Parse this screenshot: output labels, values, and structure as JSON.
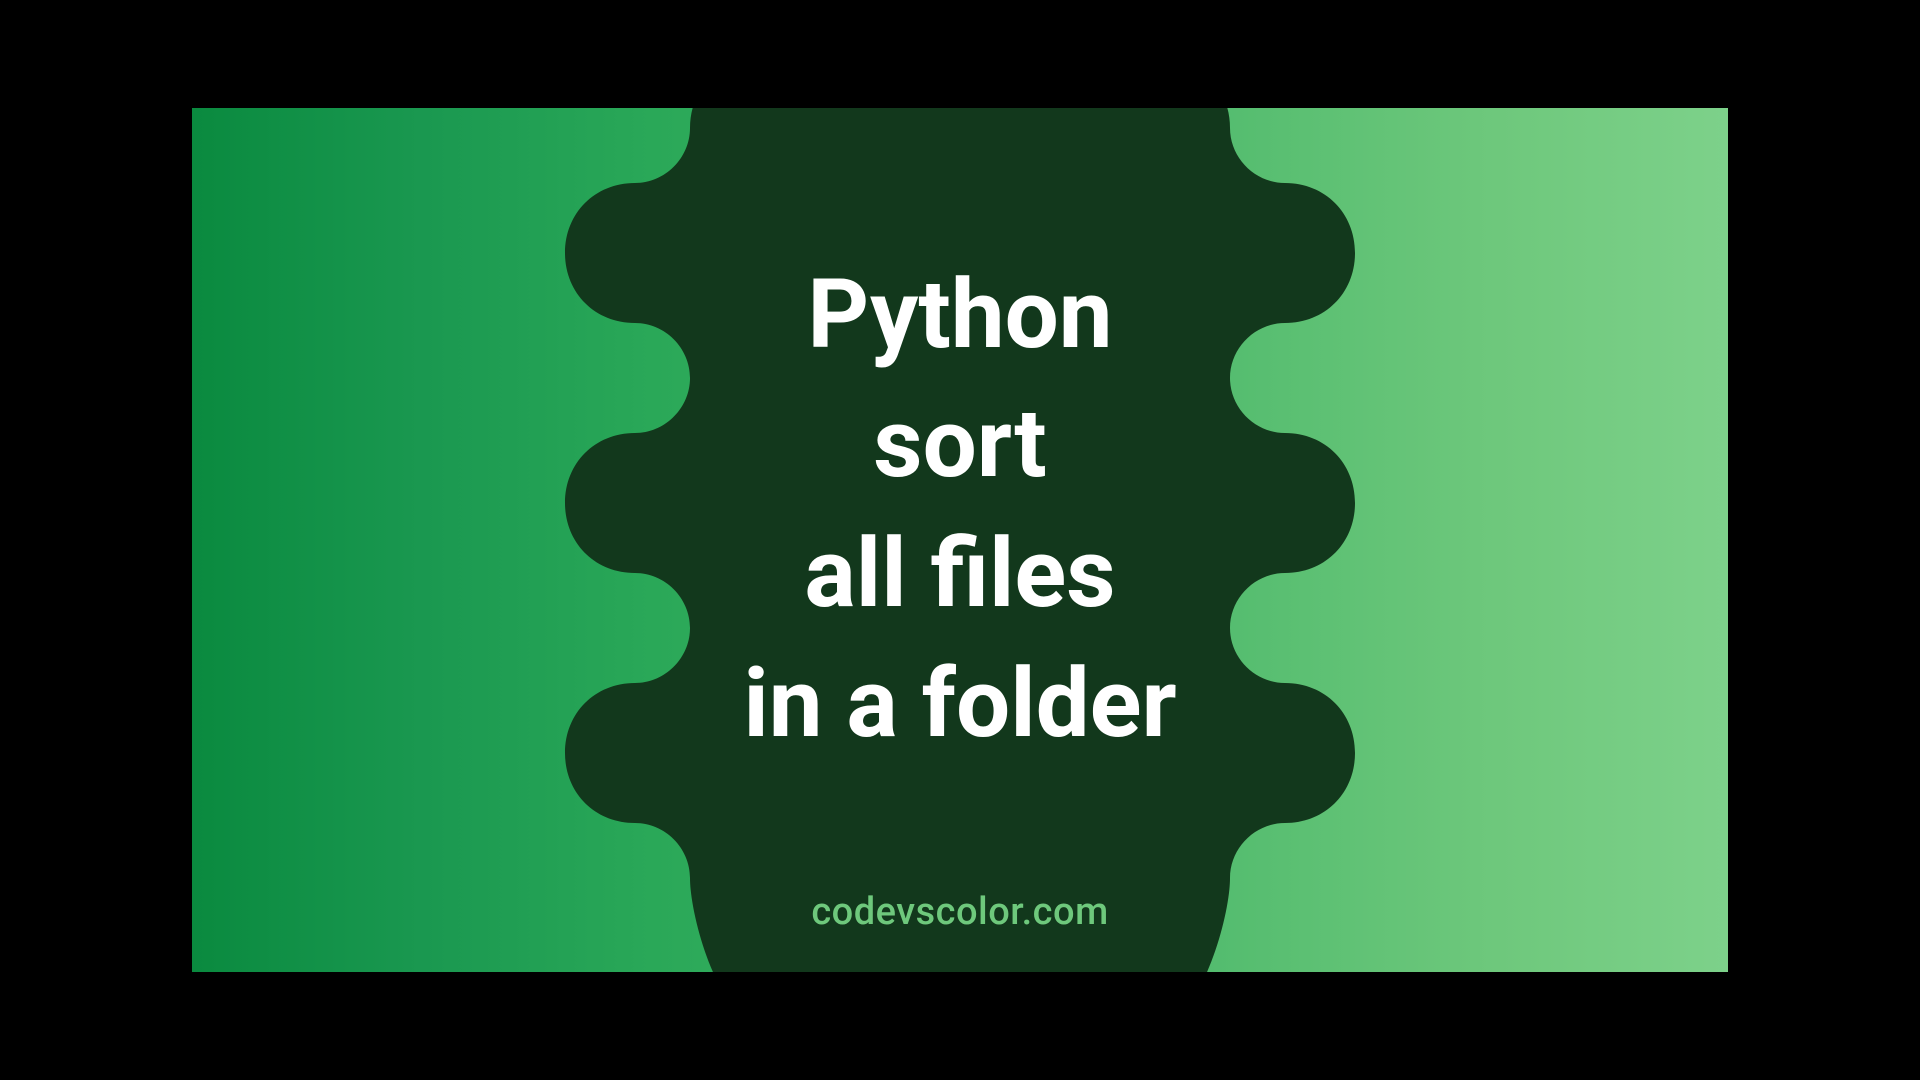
{
  "title": {
    "line1": "Python",
    "line2": "sort",
    "line3": "all files",
    "line4": "in a folder"
  },
  "watermark": "codevscolor.com",
  "colors": {
    "blob": "#12381c",
    "text": "#ffffff",
    "watermark": "#6ec87c",
    "gradient_start": "#0a8a3f",
    "gradient_end": "#7dd18a"
  }
}
